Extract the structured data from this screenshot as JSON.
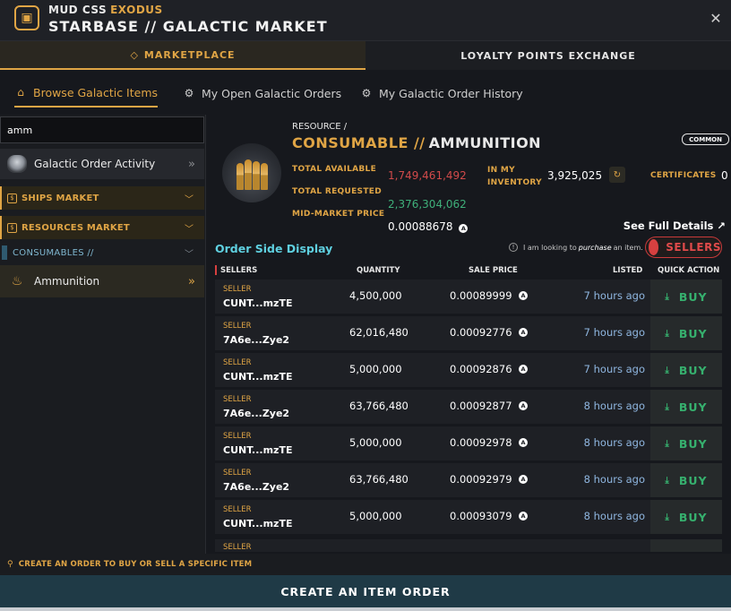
{
  "header": {
    "brand_primary": "MUD CSS",
    "brand_secondary": "EXODUS",
    "title": "STARBASE // GALACTIC MARKET",
    "close_glyph": "✕"
  },
  "top_tabs": [
    {
      "label": "MARKETPLACE",
      "active": true
    },
    {
      "label": "LOYALTY POINTS EXCHANGE",
      "active": false
    }
  ],
  "sub_tabs": [
    {
      "label": "Browse Galactic Items",
      "icon": "home-icon",
      "active": true
    },
    {
      "label": "My Open Galactic Orders",
      "icon": "gear-icon",
      "active": false
    },
    {
      "label": "My Galactic Order History",
      "icon": "gear-icon",
      "active": false
    }
  ],
  "sidebar": {
    "search_value": "amm",
    "activity_label": "Galactic Order Activity",
    "ships_label": "SHIPS MARKET",
    "resources_label": "RESOURCES MARKET",
    "consumables_label": "CONSUMABLES //",
    "ammo_label": "Ammunition"
  },
  "resource": {
    "crumb": "RESOURCE /",
    "category": "CONSUMABLE //",
    "name": "AMMUNITION",
    "rarity": "COMMON",
    "total_available_label": "TOTAL AVAILABLE",
    "total_available": "1,749,461,492",
    "total_requested_label": "TOTAL REQUESTED",
    "total_requested": "2,376,304,062",
    "mid_price_label": "MID-MARKET PRICE",
    "mid_price": "0.00088678",
    "inventory_label_1": "IN MY",
    "inventory_label_2": "INVENTORY",
    "inventory": "3,925,025",
    "certificates_label": "CERTIFICATES",
    "certificates": "0",
    "see_full_details": "See Full Details ↗"
  },
  "order_display": {
    "title": "Order Side Display",
    "info_prefix": "I am looking to",
    "info_em": "purchase",
    "info_suffix": "an item.",
    "toggle_label": "SELLERS",
    "col_sellers": "SELLERS",
    "col_quantity": "QUANTITY",
    "col_price": "SALE PRICE",
    "col_listed": "LISTED",
    "col_action": "QUICK ACTION",
    "seller_tag": "SELLER",
    "buy_label": "BUY",
    "price_icon": "A",
    "rows": [
      {
        "seller": "CUNT...mzTE",
        "quantity": "4,500,000",
        "price": "0.00089999",
        "listed": "7 hours ago"
      },
      {
        "seller": "7A6e...Zye2",
        "quantity": "62,016,480",
        "price": "0.00092776",
        "listed": "7 hours ago"
      },
      {
        "seller": "CUNT...mzTE",
        "quantity": "5,000,000",
        "price": "0.00092876",
        "listed": "7 hours ago"
      },
      {
        "seller": "7A6e...Zye2",
        "quantity": "63,766,480",
        "price": "0.00092877",
        "listed": "8 hours ago"
      },
      {
        "seller": "CUNT...mzTE",
        "quantity": "5,000,000",
        "price": "0.00092978",
        "listed": "8 hours ago"
      },
      {
        "seller": "7A6e...Zye2",
        "quantity": "63,766,480",
        "price": "0.00092979",
        "listed": "8 hours ago"
      },
      {
        "seller": "CUNT...mzTE",
        "quantity": "5,000,000",
        "price": "0.00093079",
        "listed": "8 hours ago"
      },
      {
        "seller": "",
        "quantity": "",
        "price": "",
        "listed": ""
      }
    ]
  },
  "footer": {
    "hint": "CREATE AN ORDER TO BUY OR SELL A SPECIFIC ITEM",
    "create_button": "CREATE AN ITEM ORDER"
  },
  "colors": {
    "accent": "#e0a545",
    "sell": "#d64040",
    "buy": "#36b06e",
    "cyan": "#5fd0e0"
  }
}
